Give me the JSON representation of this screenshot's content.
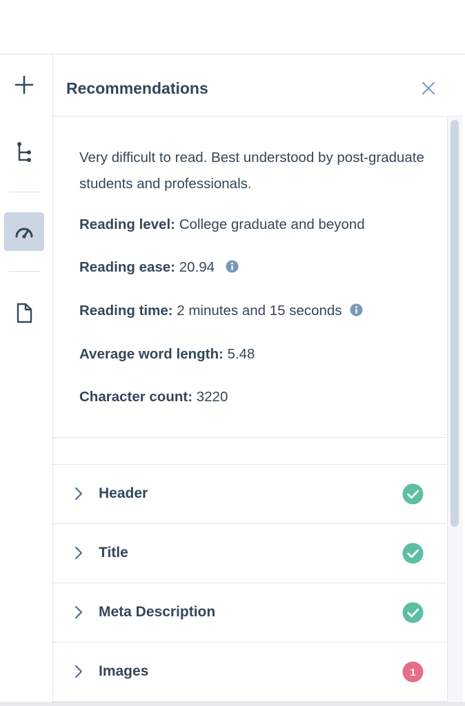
{
  "rail": {
    "items": [
      {
        "name": "add",
        "icon": "plus-icon",
        "active": false
      },
      {
        "name": "structure",
        "icon": "tree-structure-icon",
        "active": false
      },
      {
        "name": "performance",
        "icon": "gauge-icon",
        "active": true
      },
      {
        "name": "page",
        "icon": "document-icon",
        "active": false
      }
    ]
  },
  "panel": {
    "title": "Recommendations",
    "close_icon": "close-icon"
  },
  "readability": {
    "description": "Very difficult to read. Best understood by post-graduate students and professionals.",
    "reading_level": {
      "label": "Reading level:",
      "value": "College graduate and beyond"
    },
    "reading_ease": {
      "label": "Reading ease:",
      "value": "20.94"
    },
    "reading_time": {
      "label": "Reading time:",
      "value": "2 minutes and 15 seconds"
    },
    "avg_word_length": {
      "label": "Average word length:",
      "value": "5.48"
    },
    "character_count": {
      "label": "Character count:",
      "value": "3220"
    }
  },
  "sections": [
    {
      "label": "Header",
      "status": "passed",
      "icon": "check-circle-icon"
    },
    {
      "label": "Title",
      "status": "passed",
      "icon": "check-circle-icon"
    },
    {
      "label": "Meta Description",
      "status": "passed",
      "icon": "check-circle-icon"
    },
    {
      "label": "Images",
      "status": "issues",
      "count": "1",
      "icon": "alert-count-badge"
    }
  ],
  "colors": {
    "text": "#33475b",
    "success": "#5cbfa4",
    "error": "#e66e8a",
    "active_rail": "#cbd6e2",
    "border": "#dfe3eb"
  }
}
